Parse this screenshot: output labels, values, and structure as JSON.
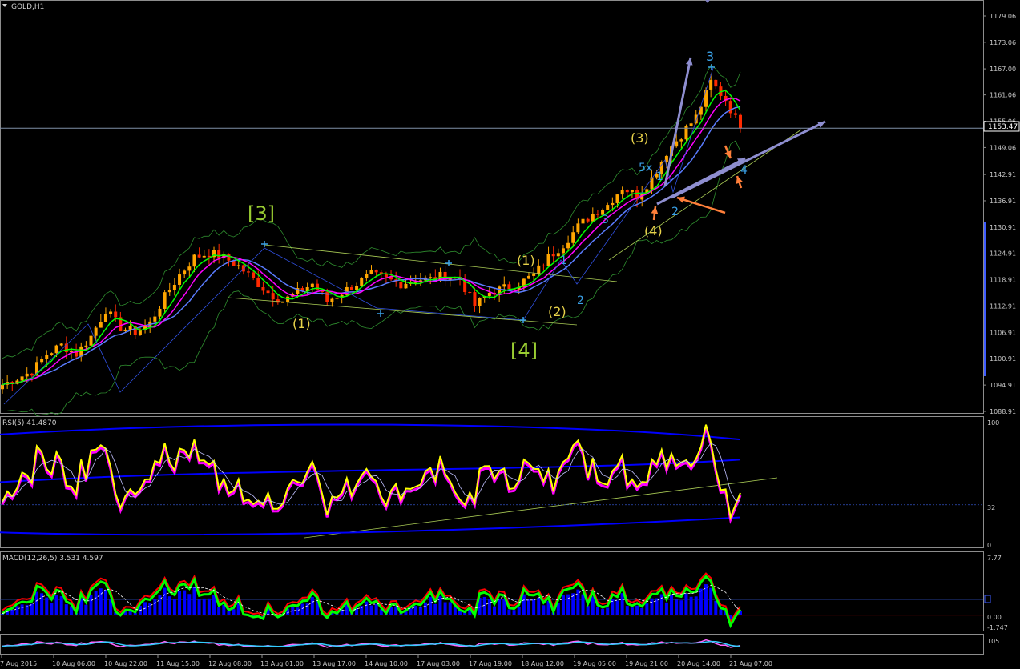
{
  "window": {
    "title": "GOLD,H1"
  },
  "colors": {
    "background": "#000000",
    "grid": "#1a1a1a",
    "axis_text": "#c8c8c8",
    "bull_candle": "#ffa500",
    "bear_candle": "#ff2a00",
    "wave_yellow": "#e8d24a",
    "wave_green": "#9acd32",
    "wave_blue": "#3aa0e6",
    "arrow_purple": "#8e8ed0",
    "arrow_orange": "#ff7f3a",
    "ma_green": "#00ff00",
    "ma_magenta": "#ff00ff",
    "ma_blue": "#5a7cff",
    "bb_band": "#2f8f2f",
    "rsi_main": "#ffff00",
    "rsi_band": "#0000ff",
    "macd_hist": "#0000ff",
    "macd_signal": "#00ff00",
    "macd_main": "#ff0000",
    "price_line": "#ffffff"
  },
  "price_scale": {
    "ticks": [
      "1179.06",
      "1173.06",
      "1167.00",
      "1161.06",
      "1155.06",
      "1149.06",
      "1142.91",
      "1136.91",
      "1130.91",
      "1124.91",
      "1118.91",
      "1112.91",
      "1106.91",
      "1100.91",
      "1094.91",
      "1088.91"
    ],
    "current_price": "1153.47"
  },
  "time_axis": {
    "labels": [
      "7 Aug 2015",
      "10 Aug 06:00",
      "10 Aug 22:00",
      "11 Aug 15:00",
      "12 Aug 08:00",
      "13 Aug 01:00",
      "13 Aug 17:00",
      "14 Aug 10:00",
      "17 Aug 03:00",
      "17 Aug 19:00",
      "18 Aug 12:00",
      "19 Aug 05:00",
      "19 Aug 21:00",
      "20 Aug 14:00",
      "21 Aug 07:00"
    ]
  },
  "wave_labels": {
    "major_3": "[3]",
    "major_4": "[4]",
    "minor_1a": "(1)",
    "minor_1b": "(1)",
    "minor_2": "(2)",
    "minor_3": "(3)",
    "minor_4": "(4)",
    "sub_1": "1",
    "sub_2": "2",
    "sub_3": "3",
    "sub_5x": "5x",
    "sub_1b": "1",
    "sub_2b": "2",
    "sub_3b": "3",
    "sub_4b": "4"
  },
  "rsi_panel": {
    "title": "RSI(5) 41.4870",
    "scale": [
      "100",
      "32",
      "0"
    ]
  },
  "macd_panel": {
    "title": "MACD(12,26,5) 3.531 4.597",
    "scale": [
      "7.77",
      "0.00",
      "-1.747"
    ]
  },
  "stoch_panel": {
    "title": "",
    "scale": [
      "105"
    ]
  },
  "chart_data": {
    "type": "candlestick",
    "symbol": "GOLD",
    "timeframe": "H1",
    "ylim": [
      1088.91,
      1179.06
    ],
    "close_path": [
      [
        0,
        1095
      ],
      [
        3,
        1096.5
      ],
      [
        6,
        1098
      ],
      [
        9,
        1102
      ],
      [
        12,
        1104
      ],
      [
        15,
        1102
      ],
      [
        18,
        1106
      ],
      [
        21,
        1112
      ],
      [
        24,
        1108
      ],
      [
        27,
        1107
      ],
      [
        30,
        1109
      ],
      [
        33,
        1115
      ],
      [
        36,
        1120
      ],
      [
        39,
        1124
      ],
      [
        42,
        1125
      ],
      [
        45,
        1124
      ],
      [
        48,
        1122
      ],
      [
        51,
        1119
      ],
      [
        54,
        1116
      ],
      [
        57,
        1114
      ],
      [
        60,
        1116
      ],
      [
        63,
        1118
      ],
      [
        66,
        1114
      ],
      [
        69,
        1116
      ],
      [
        72,
        1118
      ],
      [
        75,
        1120
      ],
      [
        78,
        1119
      ],
      [
        81,
        1118
      ],
      [
        84,
        1119
      ],
      [
        87,
        1119
      ],
      [
        90,
        1120
      ],
      [
        93,
        1119
      ],
      [
        96,
        1113
      ],
      [
        99,
        1116
      ],
      [
        102,
        1117
      ],
      [
        105,
        1118
      ],
      [
        108,
        1120
      ],
      [
        111,
        1124
      ],
      [
        114,
        1127
      ],
      [
        117,
        1131
      ],
      [
        120,
        1134
      ],
      [
        123,
        1136
      ],
      [
        126,
        1140
      ],
      [
        129,
        1138
      ],
      [
        132,
        1142
      ],
      [
        135,
        1148
      ],
      [
        138,
        1152
      ],
      [
        141,
        1156
      ],
      [
        144,
        1164
      ],
      [
        147,
        1160
      ],
      [
        150,
        1153.47
      ]
    ],
    "bars": 151
  }
}
